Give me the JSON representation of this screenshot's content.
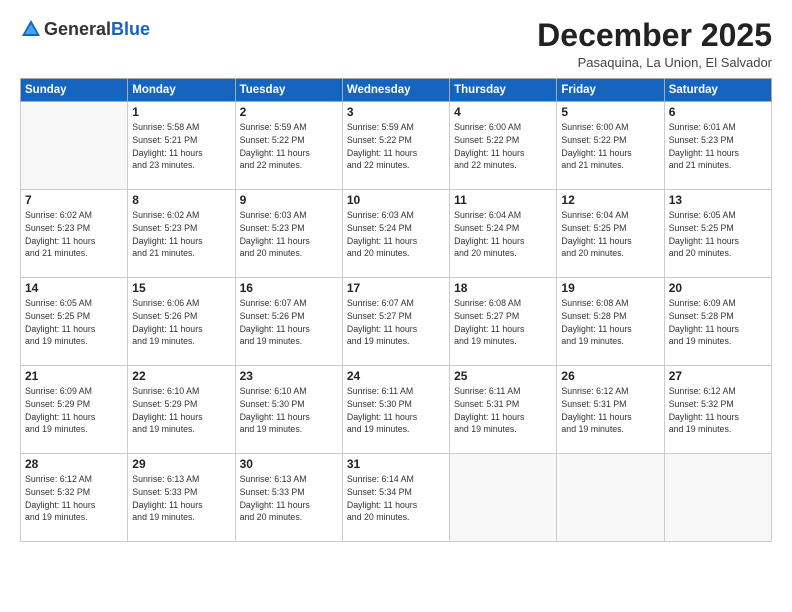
{
  "logo": {
    "general": "General",
    "blue": "Blue"
  },
  "title": "December 2025",
  "location": "Pasaquina, La Union, El Salvador",
  "days_header": [
    "Sunday",
    "Monday",
    "Tuesday",
    "Wednesday",
    "Thursday",
    "Friday",
    "Saturday"
  ],
  "weeks": [
    [
      {
        "day": "",
        "info": ""
      },
      {
        "day": "1",
        "info": "Sunrise: 5:58 AM\nSunset: 5:21 PM\nDaylight: 11 hours\nand 23 minutes."
      },
      {
        "day": "2",
        "info": "Sunrise: 5:59 AM\nSunset: 5:22 PM\nDaylight: 11 hours\nand 22 minutes."
      },
      {
        "day": "3",
        "info": "Sunrise: 5:59 AM\nSunset: 5:22 PM\nDaylight: 11 hours\nand 22 minutes."
      },
      {
        "day": "4",
        "info": "Sunrise: 6:00 AM\nSunset: 5:22 PM\nDaylight: 11 hours\nand 22 minutes."
      },
      {
        "day": "5",
        "info": "Sunrise: 6:00 AM\nSunset: 5:22 PM\nDaylight: 11 hours\nand 21 minutes."
      },
      {
        "day": "6",
        "info": "Sunrise: 6:01 AM\nSunset: 5:23 PM\nDaylight: 11 hours\nand 21 minutes."
      }
    ],
    [
      {
        "day": "7",
        "info": "Sunrise: 6:02 AM\nSunset: 5:23 PM\nDaylight: 11 hours\nand 21 minutes."
      },
      {
        "day": "8",
        "info": "Sunrise: 6:02 AM\nSunset: 5:23 PM\nDaylight: 11 hours\nand 21 minutes."
      },
      {
        "day": "9",
        "info": "Sunrise: 6:03 AM\nSunset: 5:23 PM\nDaylight: 11 hours\nand 20 minutes."
      },
      {
        "day": "10",
        "info": "Sunrise: 6:03 AM\nSunset: 5:24 PM\nDaylight: 11 hours\nand 20 minutes."
      },
      {
        "day": "11",
        "info": "Sunrise: 6:04 AM\nSunset: 5:24 PM\nDaylight: 11 hours\nand 20 minutes."
      },
      {
        "day": "12",
        "info": "Sunrise: 6:04 AM\nSunset: 5:25 PM\nDaylight: 11 hours\nand 20 minutes."
      },
      {
        "day": "13",
        "info": "Sunrise: 6:05 AM\nSunset: 5:25 PM\nDaylight: 11 hours\nand 20 minutes."
      }
    ],
    [
      {
        "day": "14",
        "info": "Sunrise: 6:05 AM\nSunset: 5:25 PM\nDaylight: 11 hours\nand 19 minutes."
      },
      {
        "day": "15",
        "info": "Sunrise: 6:06 AM\nSunset: 5:26 PM\nDaylight: 11 hours\nand 19 minutes."
      },
      {
        "day": "16",
        "info": "Sunrise: 6:07 AM\nSunset: 5:26 PM\nDaylight: 11 hours\nand 19 minutes."
      },
      {
        "day": "17",
        "info": "Sunrise: 6:07 AM\nSunset: 5:27 PM\nDaylight: 11 hours\nand 19 minutes."
      },
      {
        "day": "18",
        "info": "Sunrise: 6:08 AM\nSunset: 5:27 PM\nDaylight: 11 hours\nand 19 minutes."
      },
      {
        "day": "19",
        "info": "Sunrise: 6:08 AM\nSunset: 5:28 PM\nDaylight: 11 hours\nand 19 minutes."
      },
      {
        "day": "20",
        "info": "Sunrise: 6:09 AM\nSunset: 5:28 PM\nDaylight: 11 hours\nand 19 minutes."
      }
    ],
    [
      {
        "day": "21",
        "info": "Sunrise: 6:09 AM\nSunset: 5:29 PM\nDaylight: 11 hours\nand 19 minutes."
      },
      {
        "day": "22",
        "info": "Sunrise: 6:10 AM\nSunset: 5:29 PM\nDaylight: 11 hours\nand 19 minutes."
      },
      {
        "day": "23",
        "info": "Sunrise: 6:10 AM\nSunset: 5:30 PM\nDaylight: 11 hours\nand 19 minutes."
      },
      {
        "day": "24",
        "info": "Sunrise: 6:11 AM\nSunset: 5:30 PM\nDaylight: 11 hours\nand 19 minutes."
      },
      {
        "day": "25",
        "info": "Sunrise: 6:11 AM\nSunset: 5:31 PM\nDaylight: 11 hours\nand 19 minutes."
      },
      {
        "day": "26",
        "info": "Sunrise: 6:12 AM\nSunset: 5:31 PM\nDaylight: 11 hours\nand 19 minutes."
      },
      {
        "day": "27",
        "info": "Sunrise: 6:12 AM\nSunset: 5:32 PM\nDaylight: 11 hours\nand 19 minutes."
      }
    ],
    [
      {
        "day": "28",
        "info": "Sunrise: 6:12 AM\nSunset: 5:32 PM\nDaylight: 11 hours\nand 19 minutes."
      },
      {
        "day": "29",
        "info": "Sunrise: 6:13 AM\nSunset: 5:33 PM\nDaylight: 11 hours\nand 19 minutes."
      },
      {
        "day": "30",
        "info": "Sunrise: 6:13 AM\nSunset: 5:33 PM\nDaylight: 11 hours\nand 20 minutes."
      },
      {
        "day": "31",
        "info": "Sunrise: 6:14 AM\nSunset: 5:34 PM\nDaylight: 11 hours\nand 20 minutes."
      },
      {
        "day": "",
        "info": ""
      },
      {
        "day": "",
        "info": ""
      },
      {
        "day": "",
        "info": ""
      }
    ]
  ]
}
